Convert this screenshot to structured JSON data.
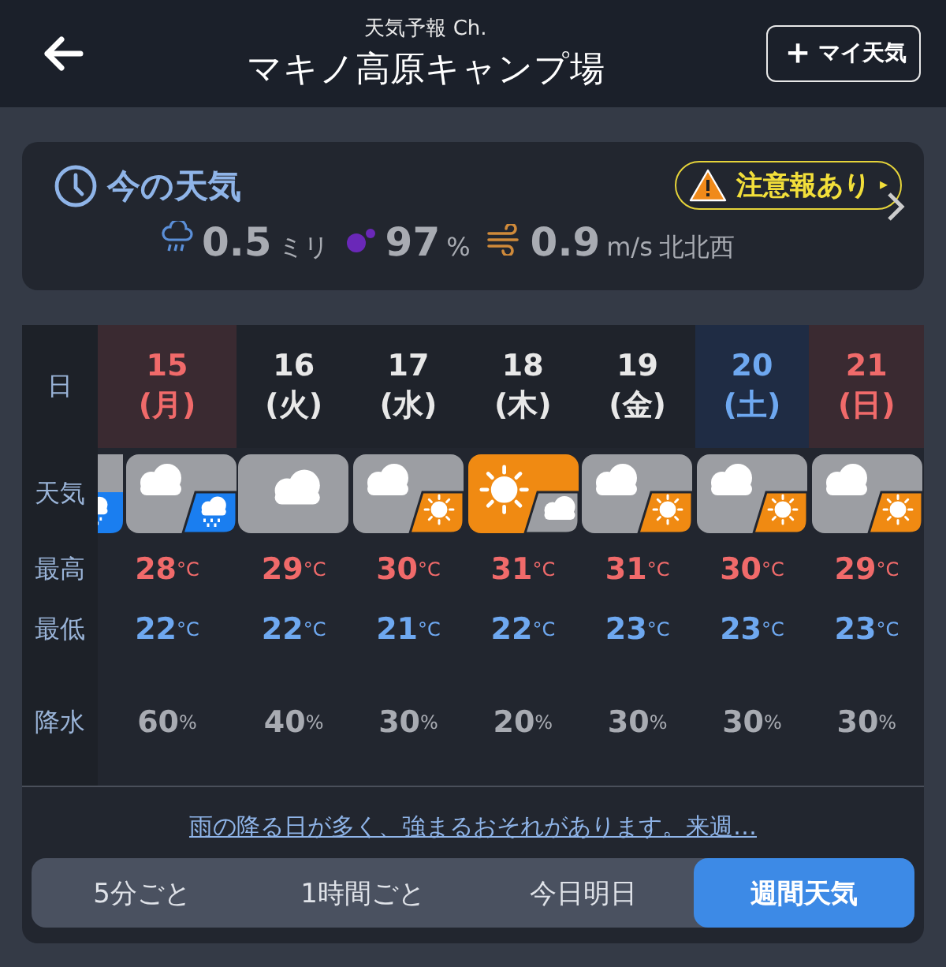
{
  "header": {
    "subtitle": "天気予報 Ch.",
    "title": "マキノ高原キャンプ場",
    "add_button": {
      "icon": "＋",
      "label": "マイ天気"
    }
  },
  "current": {
    "title": "今の天気",
    "warning": "注意報あり",
    "warning_caret": "▸",
    "metrics": [
      {
        "kind": "rain",
        "value": "0.5",
        "unit": "ミリ"
      },
      {
        "kind": "humidity",
        "value": "97",
        "unit": "%"
      },
      {
        "kind": "wind",
        "value": "0.9",
        "unit": "m/s",
        "extra": "北北西"
      }
    ]
  },
  "forecast": {
    "row_labels": {
      "date": "日",
      "weather": "天気",
      "high": "最高",
      "low": "最低",
      "rain": "降水"
    },
    "scrolled_icon": {
      "kind": "rain"
    },
    "days": [
      {
        "date": "15",
        "weekday": "(月)",
        "kind": "holiday",
        "icon": {
          "kind": "cloudrain"
        },
        "high": "28",
        "high_unit": "°C",
        "low": "22",
        "low_unit": "°C",
        "rain": "60",
        "rain_unit": "%"
      },
      {
        "date": "16",
        "weekday": "(火)",
        "kind": "weekday",
        "icon": {
          "kind": "cloud"
        },
        "high": "29",
        "high_unit": "°C",
        "low": "22",
        "low_unit": "°C",
        "rain": "40",
        "rain_unit": "%"
      },
      {
        "date": "17",
        "weekday": "(水)",
        "kind": "weekday",
        "icon": {
          "kind": "cloudsun"
        },
        "high": "30",
        "high_unit": "°C",
        "low": "21",
        "low_unit": "°C",
        "rain": "30",
        "rain_unit": "%"
      },
      {
        "date": "18",
        "weekday": "(木)",
        "kind": "weekday",
        "icon": {
          "kind": "suncloud"
        },
        "high": "31",
        "high_unit": "°C",
        "low": "22",
        "low_unit": "°C",
        "rain": "20",
        "rain_unit": "%"
      },
      {
        "date": "19",
        "weekday": "(金)",
        "kind": "weekday",
        "icon": {
          "kind": "cloudsun"
        },
        "high": "31",
        "high_unit": "°C",
        "low": "23",
        "low_unit": "°C",
        "rain": "30",
        "rain_unit": "%"
      },
      {
        "date": "20",
        "weekday": "(土)",
        "kind": "saturday",
        "icon": {
          "kind": "cloudsun"
        },
        "high": "30",
        "high_unit": "°C",
        "low": "23",
        "low_unit": "°C",
        "rain": "30",
        "rain_unit": "%"
      },
      {
        "date": "21",
        "weekday": "(日)",
        "kind": "sunday",
        "icon": {
          "kind": "cloudsun"
        },
        "high": "29",
        "high_unit": "°C",
        "low": "23",
        "low_unit": "°C",
        "rain": "30",
        "rain_unit": "%"
      }
    ],
    "summary": "雨の降る日が多く、強まるおそれがあります。来週…"
  },
  "tabs": [
    {
      "label": "5分ごと",
      "selected": false
    },
    {
      "label": "1時間ごと",
      "selected": false
    },
    {
      "label": "今日明日",
      "selected": false
    },
    {
      "label": "週間天気",
      "selected": true
    }
  ]
}
